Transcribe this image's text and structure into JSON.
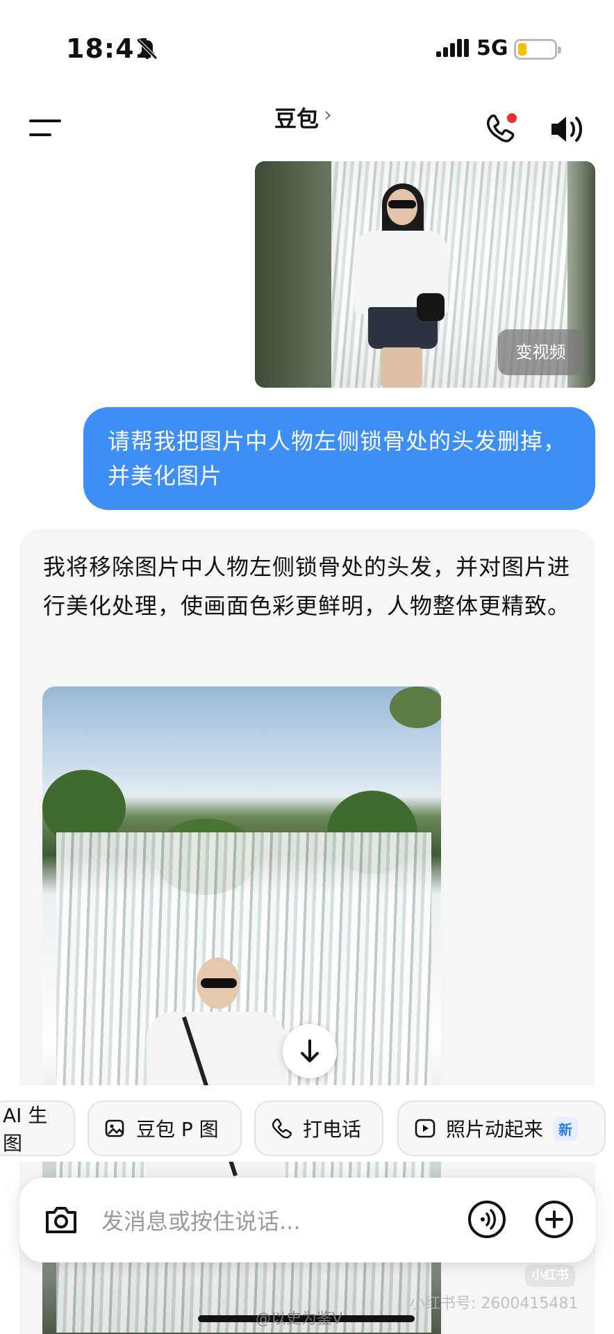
{
  "status_bar": {
    "time": "18:41",
    "network": "5G"
  },
  "header": {
    "title": "豆包",
    "chevron": "›"
  },
  "messages": {
    "image1_button": "变视频",
    "user_text": "请帮我把图片中人物左侧锁骨处的头发删掉，并美化图片",
    "assistant_text": "我将移除图片中人物左侧锁骨处的头发，并对图片进行美化处理，使画面色彩更鲜明，人物整体更精致。"
  },
  "chips": [
    {
      "label": "AI 生图",
      "icon": "sparkle-icon"
    },
    {
      "label": "豆包 P 图",
      "icon": "image-edit-icon"
    },
    {
      "label": "打电话",
      "icon": "phone-icon"
    },
    {
      "label": "照片动起来",
      "icon": "play-icon",
      "badge": "新"
    }
  ],
  "input": {
    "placeholder": "发消息或按住说话..."
  },
  "watermarks": {
    "xhs_logo": "小红书",
    "xhs_id": "小红书号: 2600415481",
    "weibo": "@以史为鉴V"
  },
  "colors": {
    "accent": "#3d8ef5",
    "bubble_bg": "#f5f5f6"
  }
}
